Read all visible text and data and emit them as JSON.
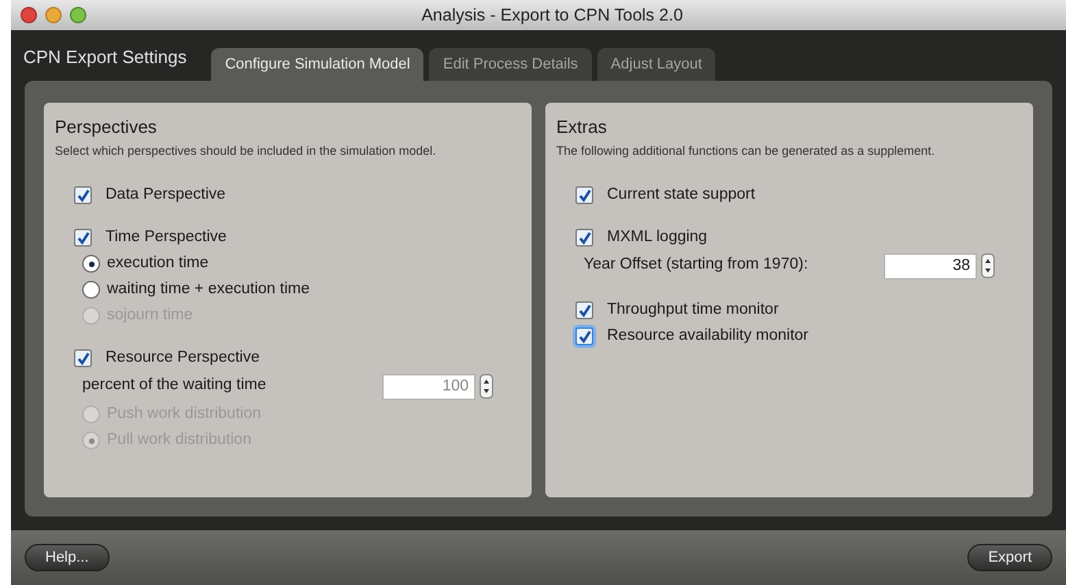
{
  "window": {
    "title": "Analysis - Export to CPN Tools 2.0"
  },
  "header": {
    "title": "CPN Export Settings"
  },
  "tabs": [
    {
      "label": "Configure Simulation Model",
      "selected": true
    },
    {
      "label": "Edit Process Details",
      "selected": false
    },
    {
      "label": "Adjust Layout",
      "selected": false
    }
  ],
  "panels": [
    {
      "title": "Perspectives",
      "description": "Select which perspectives should be included in the simulation model.",
      "groups": [
        {
          "items": [
            {
              "kind": "checkbox",
              "label": "Data Perspective",
              "checked": true,
              "disabled": false,
              "focused": false
            }
          ]
        },
        {
          "items": [
            {
              "kind": "checkbox",
              "label": "Time Perspective",
              "checked": true,
              "disabled": false,
              "focused": false
            },
            {
              "kind": "radio",
              "label": "execution time",
              "selected": true,
              "disabled": false
            },
            {
              "kind": "radio",
              "label": "waiting time + execution time",
              "selected": false,
              "disabled": false
            },
            {
              "kind": "radio",
              "label": "sojourn time",
              "selected": false,
              "disabled": true
            }
          ]
        },
        {
          "items": [
            {
              "kind": "checkbox",
              "label": "Resource Perspective",
              "checked": true,
              "disabled": false,
              "focused": false
            },
            {
              "kind": "spinner",
              "label": "percent of the waiting time",
              "value": "100",
              "disabled": true
            },
            {
              "kind": "radio",
              "label": "Push work distribution",
              "selected": false,
              "disabled": true
            },
            {
              "kind": "radio",
              "label": "Pull work distribution",
              "selected": true,
              "disabled": true
            }
          ]
        }
      ]
    },
    {
      "title": "Extras",
      "description": "The following additional functions can be generated as a supplement.",
      "groups": [
        {
          "items": [
            {
              "kind": "checkbox",
              "label": "Current state support",
              "checked": true,
              "disabled": false,
              "focused": false
            }
          ]
        },
        {
          "items": [
            {
              "kind": "checkbox",
              "label": "MXML logging",
              "checked": true,
              "disabled": false,
              "focused": false
            },
            {
              "kind": "spinner",
              "label": "Year Offset (starting from 1970):",
              "value": "38",
              "disabled": false
            }
          ]
        },
        {
          "items": [
            {
              "kind": "checkbox",
              "label": "Throughput time monitor",
              "checked": true,
              "disabled": false,
              "focused": false
            },
            {
              "kind": "checkbox",
              "label": "Resource availability monitor",
              "checked": true,
              "disabled": false,
              "focused": true
            }
          ]
        }
      ]
    }
  ],
  "buttons": {
    "left": "Help...",
    "right": "Export"
  }
}
